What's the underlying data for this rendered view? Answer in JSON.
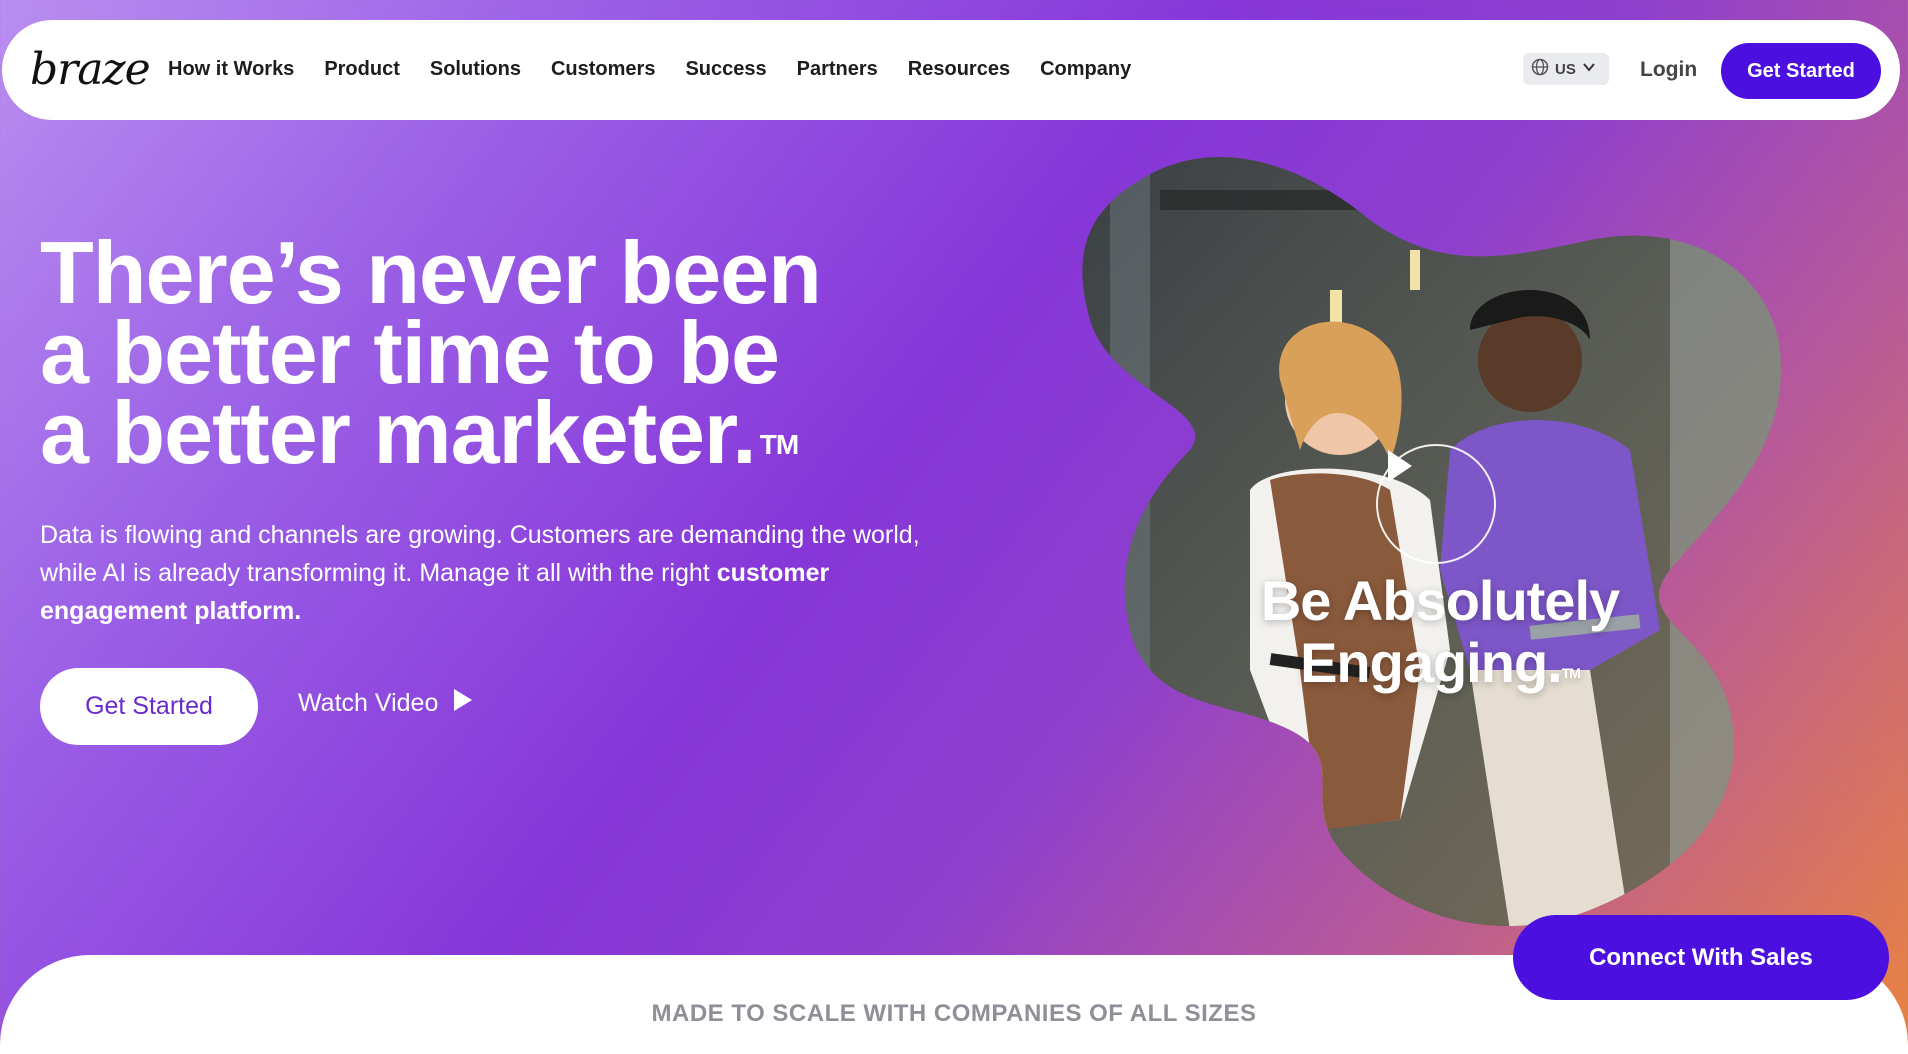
{
  "brand": {
    "logo_text": "braze"
  },
  "nav": {
    "links": [
      "How it Works",
      "Product",
      "Solutions",
      "Customers",
      "Success",
      "Partners",
      "Resources",
      "Company"
    ],
    "region": "US",
    "login": "Login",
    "cta": "Get Started"
  },
  "hero": {
    "headline_lines": [
      "There’s never been",
      "a better time to be",
      "a better marketer."
    ],
    "trademark": "TM",
    "subtext_plain": "Data is flowing and channels are growing. Customers are demanding the world, while AI is already transforming it. Manage it all with the right ",
    "subtext_bold": "customer engagement platform.",
    "cta_primary": "Get Started",
    "cta_secondary": "Watch Video"
  },
  "video": {
    "overlay_line1": "Be Absolutely",
    "overlay_line2": "Engaging.",
    "trademark": "TM"
  },
  "section": {
    "title": "MADE TO SCALE WITH COMPANIES OF ALL SIZES"
  },
  "floating": {
    "sales_cta": "Connect With Sales"
  },
  "colors": {
    "accent": "#4b0fe0",
    "hero_purple": "#8736d8",
    "hero_orange": "#e98340"
  },
  "icons": [
    "globe-icon",
    "chevron-down-icon",
    "play-icon"
  ]
}
